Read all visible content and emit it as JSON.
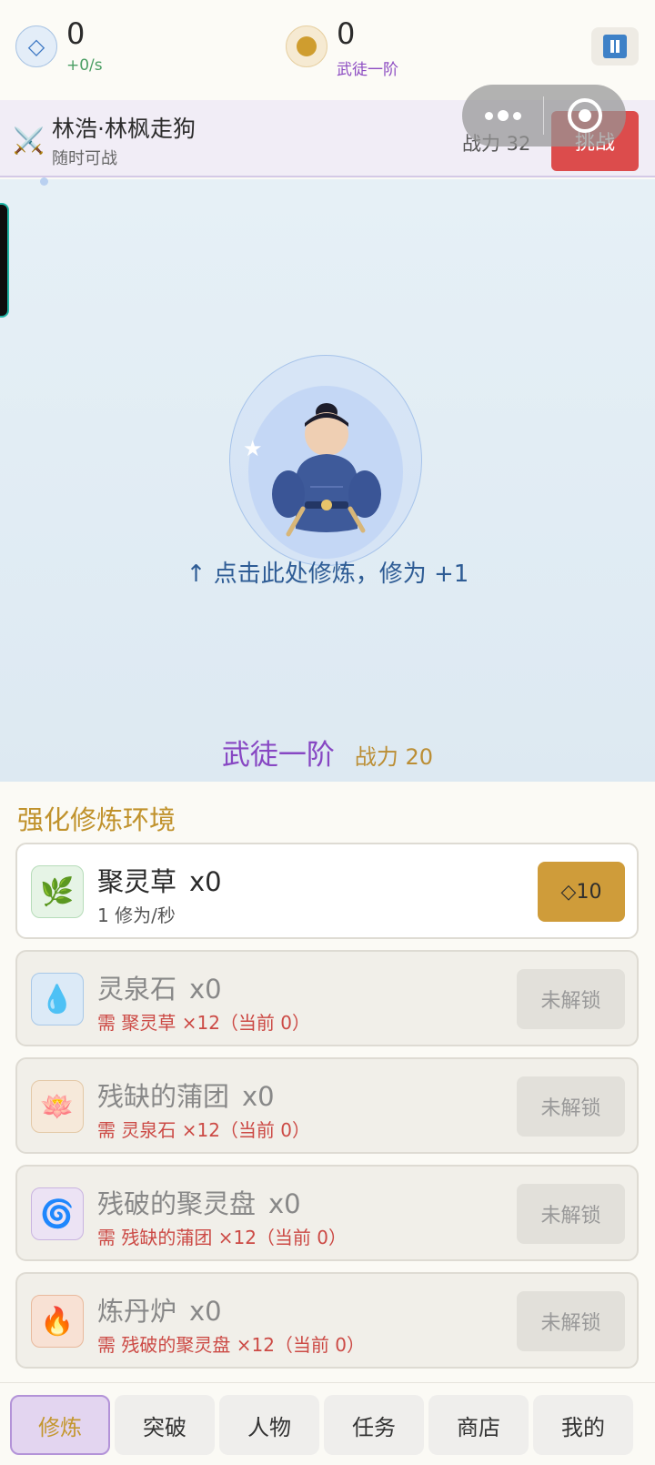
{
  "resources": {
    "lingshi": {
      "icon": "diamond-icon",
      "value": "0",
      "rate": "+0/s"
    },
    "coin": {
      "icon": "coin-icon",
      "value": "0",
      "rank": "武徒一阶"
    }
  },
  "pause_icon": "pause-icon",
  "opponent": {
    "icon": "crossed-swords-icon",
    "name": "林浩·林枫走狗",
    "status": "随时可战",
    "power": "战力 32",
    "challenge_label": "挑战"
  },
  "capsule": {
    "more_icon": "more-dots-icon",
    "close_icon": "target-icon"
  },
  "stage": {
    "tap_hint": "↑ 点击此处修炼，修为 +1",
    "realm": "武徒一阶",
    "power": "战力 20"
  },
  "upgrades": {
    "title": "强化修炼环境",
    "items": [
      {
        "icon": "herb-icon",
        "glyph": "🌿",
        "name": "聚灵草",
        "count": "x0",
        "desc": "1 修为/秒",
        "price": "◇10",
        "locked": false,
        "icon_bg": "#e6f4e6",
        "icon_border": "#b6dcb9"
      },
      {
        "icon": "water-drop-icon",
        "glyph": "💧",
        "name": "灵泉石",
        "count": "x0",
        "desc": "需 聚灵草 ×12（当前 0）",
        "lock_label": "未解锁",
        "locked": true,
        "icon_bg": "#dceaf7",
        "icon_border": "#a8c8e8"
      },
      {
        "icon": "lotus-icon",
        "glyph": "🪷",
        "name": "残缺的蒲团",
        "count": "x0",
        "desc": "需 灵泉石 ×12（当前 0）",
        "lock_label": "未解锁",
        "locked": true,
        "icon_bg": "#f6e9da",
        "icon_border": "#e3c8a6"
      },
      {
        "icon": "spiral-icon",
        "glyph": "🌀",
        "name": "残破的聚灵盘",
        "count": "x0",
        "desc": "需 残缺的蒲团 ×12（当前 0）",
        "lock_label": "未解锁",
        "locked": true,
        "icon_bg": "#ece3f4",
        "icon_border": "#c9b4e0"
      },
      {
        "icon": "fire-icon",
        "glyph": "🔥",
        "name": "炼丹炉",
        "count": "x0",
        "desc": "需 残破的聚灵盘 ×12（当前 0）",
        "lock_label": "未解锁",
        "locked": true,
        "icon_bg": "#f8e1d4",
        "icon_border": "#e8b99c"
      }
    ]
  },
  "nav": {
    "items": [
      {
        "label": "修炼",
        "active": true
      },
      {
        "label": "突破",
        "active": false
      },
      {
        "label": "人物",
        "active": false
      },
      {
        "label": "任务",
        "active": false
      },
      {
        "label": "商店",
        "active": false
      },
      {
        "label": "我的",
        "active": false
      }
    ]
  },
  "colors": {
    "accent_gold": "#cf9c3a",
    "realm_purple": "#8747c3",
    "challenge_red": "#dc4c4c",
    "lock_text_red": "#cc4a45"
  }
}
